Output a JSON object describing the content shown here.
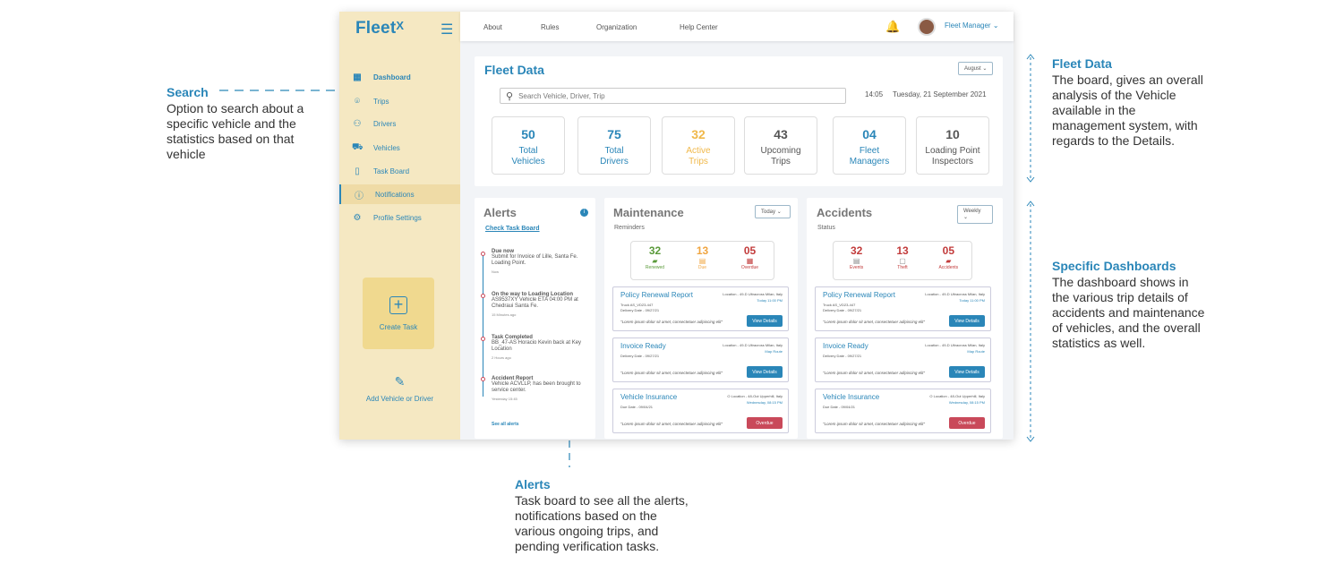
{
  "annotations": {
    "search": {
      "title": "Search",
      "lines": [
        "Option to search about a",
        "specific vehicle and the",
        "statistics based on that",
        "vehicle"
      ]
    },
    "fleet_data": {
      "title": "Fleet Data",
      "lines": [
        "The board, gives an overall",
        "analysis of the Vehicle",
        "available in the",
        "management system, with",
        "regards to the Details."
      ]
    },
    "specific": {
      "title": "Specific Dashboards",
      "lines": [
        "The dashboard shows in",
        "the various trip details of",
        "accidents and maintenance",
        "of vehicles, and the overall",
        "statistics as well."
      ]
    },
    "alerts": {
      "title": "Alerts",
      "lines": [
        "Task board to see all the alerts,",
        "notifications based on  the",
        "various ongoing trips, and",
        "pending verification tasks."
      ]
    }
  },
  "app": {
    "logo": "Fleet",
    "logo_mark": "X",
    "sidebar": {
      "items": [
        {
          "label": "Dashboard",
          "icon": "grid-icon"
        },
        {
          "label": "Trips",
          "icon": "pin-icon"
        },
        {
          "label": "Drivers",
          "icon": "users-icon"
        },
        {
          "label": "Vehicles",
          "icon": "truck-icon"
        },
        {
          "label": "Task Board",
          "icon": "doc-icon"
        },
        {
          "label": "Notifications",
          "icon": "info-icon"
        },
        {
          "label": "Profile Settings",
          "icon": "gear-icon"
        }
      ],
      "create_task": "Create Task",
      "add_vehicle_driver": "Add Vehicle or Driver"
    },
    "topbar": {
      "links": [
        "About",
        "Rules",
        "Organization",
        "Help Center"
      ],
      "user": "Fleet Manager"
    },
    "fleet": {
      "title": "Fleet Data",
      "month": "August",
      "search_placeholder": "Search Vehicle, Driver, Trip",
      "time": "14:05",
      "date": "Tuesday, 21 September 2021",
      "stats": [
        {
          "value": "50",
          "label1": "Total",
          "label2": "Vehicles"
        },
        {
          "value": "75",
          "label1": "Total",
          "label2": "Drivers"
        },
        {
          "value": "32",
          "label1": "Active",
          "label2": "Trips"
        },
        {
          "value": "43",
          "label1": "Upcoming",
          "label2": "Trips"
        },
        {
          "value": "04",
          "label1": "Fleet",
          "label2": "Managers"
        },
        {
          "value": "10",
          "label1": "Loading Point",
          "label2": "Inspectors"
        }
      ]
    },
    "alerts": {
      "title": "Alerts",
      "link": "Check Task Board",
      "items": [
        {
          "title": "Due now",
          "desc": "Submit for Invoice of Lille, Santa Fe. Loading Point.",
          "time": "Now"
        },
        {
          "title": "On the way to Loading Location",
          "desc": "AS9537XY Vehicle ETA 04:00 PM at Chedraui Santa Fe.",
          "time": "15 Minutes ago"
        },
        {
          "title": "Task Completed",
          "desc": "BB_47-AS Horacio Kevin back at Key Location",
          "time": "2 Hours ago"
        },
        {
          "title": "Accident Report",
          "desc": "Vehicle ACVLLP, has been brought to service center.",
          "time": "Yesterday 15:45"
        }
      ],
      "see_all": "See all alerts"
    },
    "maintenance": {
      "title": "Maintenance",
      "sub": "Reminders",
      "filter": "Today",
      "summary": [
        {
          "value": "32",
          "label": "Renewed"
        },
        {
          "value": "13",
          "label": "Due"
        },
        {
          "value": "05",
          "label": "Overdue"
        }
      ],
      "records": [
        {
          "title": "Policy Renewal Report",
          "loc": "Location - 49-D Ultracross Milan, Italy",
          "s1": "Truck AS_VD23-447",
          "s2": "Delivery Date - 09/27/21",
          "d1": "Today 11:00 PM",
          "quote": "\"Lorem ipsum dolor sit amet, consectetuer adipiscing elit\"",
          "btn": "View Details"
        },
        {
          "title": "Invoice Ready",
          "loc": "Location - 49-D Ultracross Milan, Italy",
          "s1": "Delivery Date - 09/27/21",
          "s2": "",
          "d1": "Map Route",
          "quote": "\"Lorem ipsum dolor sit amet, consectetuer adipiscing elit\"",
          "btn": "View Details"
        },
        {
          "title": "Vehicle Insurance",
          "loc": "O Location - 48-Out Upperhill, Italy",
          "s1": "Due Date - 09/04/21",
          "s2": "",
          "d1": "Wednesday, 08:15 PM",
          "quote": "\"Lorem ipsum dolor sit amet, consectetuer adipiscing elit\"",
          "btn": "Overdue"
        }
      ]
    },
    "accidents": {
      "title": "Accidents",
      "sub": "Status",
      "filter": "Weekly",
      "summary": [
        {
          "value": "32",
          "label": "Events"
        },
        {
          "value": "13",
          "label": "Theft"
        },
        {
          "value": "05",
          "label": "Accidents"
        }
      ],
      "records": [
        {
          "title": "Policy Renewal Report",
          "loc": "Location - 49-D Ultracross Milan, Italy",
          "s1": "Truck AS_VD23-447",
          "s2": "Delivery Date - 09/27/21",
          "d1": "Today 11:00 PM",
          "quote": "\"Lorem ipsum dolor sit amet, consectetuer adipiscing elit\"",
          "btn": "View Details"
        },
        {
          "title": "Invoice Ready",
          "loc": "Location - 49-D Ultracross Milan, Italy",
          "s1": "Delivery Date - 09/27/21",
          "s2": "",
          "d1": "Map Route",
          "quote": "\"Lorem ipsum dolor sit amet, consectetuer adipiscing elit\"",
          "btn": "View Details"
        },
        {
          "title": "Vehicle Insurance",
          "loc": "O Location - 48-Out Upperhill, Italy",
          "s1": "Due Date - 09/04/21",
          "s2": "",
          "d1": "Wednesday, 08:15 PM",
          "quote": "\"Lorem ipsum dolor sit amet, consectetuer adipiscing elit\"",
          "btn": "Overdue"
        }
      ]
    }
  },
  "colors": {
    "brand": "#2a86b8",
    "sidebar": "#f5e8c2",
    "accent_yellow": "#f0b84a",
    "danger": "#c9495a"
  }
}
